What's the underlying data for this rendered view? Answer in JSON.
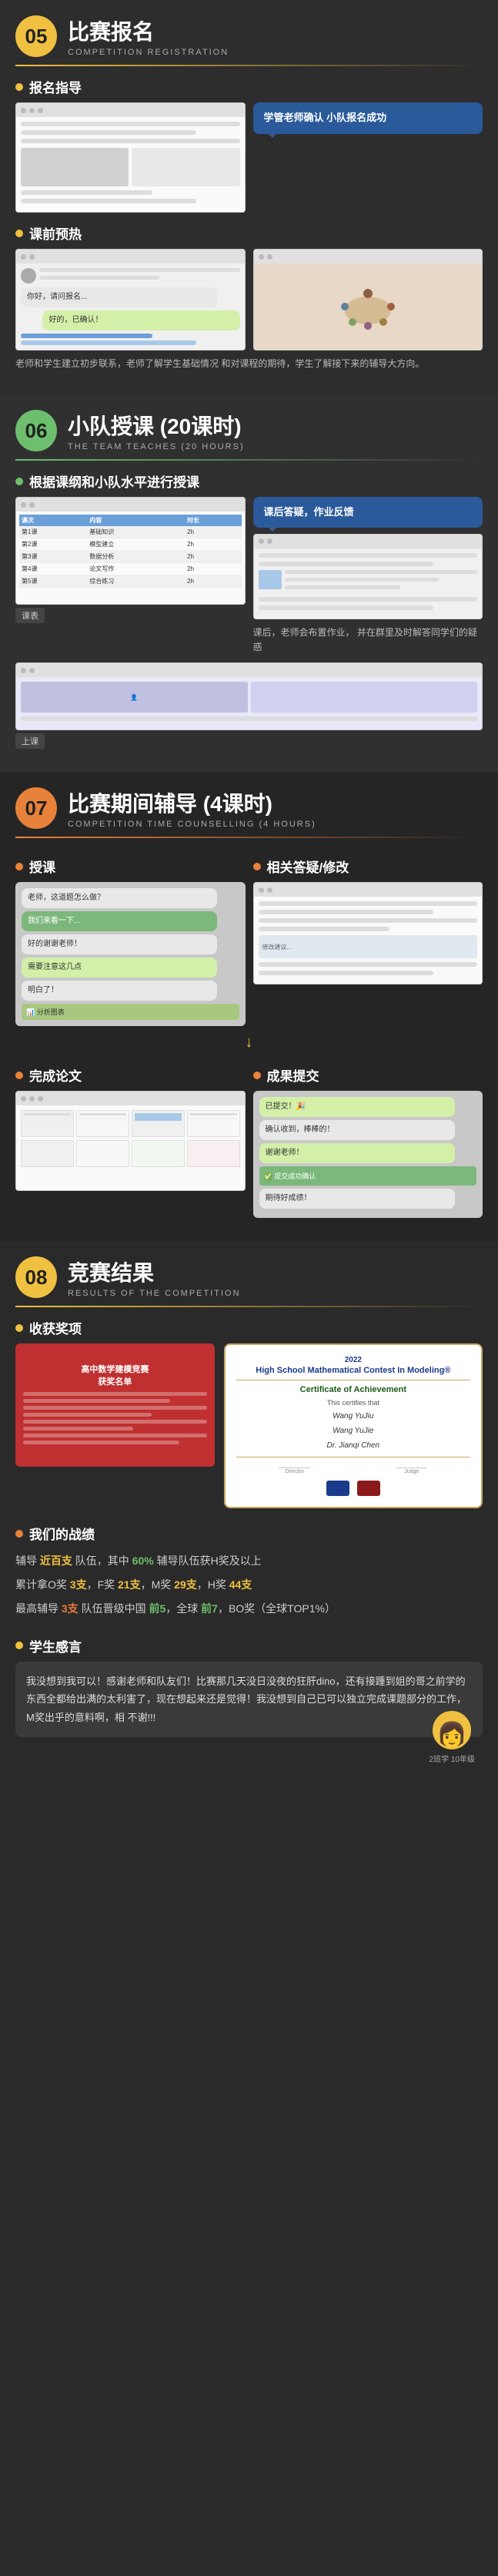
{
  "sections": {
    "s05": {
      "num": "05",
      "num_color": "yellow",
      "title": "比赛报名",
      "subtitle": "COMPETITION REGISTRATION",
      "items": [
        {
          "label": "报名指导",
          "dot_color": "yellow"
        }
      ],
      "callout1": "学管老师确认\n小队报名成功",
      "label1": "课前预热",
      "caption1": "老师和学生建立初步联系，老师了解学生基础情况\n和对课程的期待，学生了解接下来的辅导大方向。"
    },
    "s06": {
      "num": "06",
      "num_color": "green",
      "title": "小队授课 (20课时)",
      "subtitle": "THE TEAM TEACHES (20 HOURS)",
      "item1": "根据课纲和小队水平进行授课",
      "label_table": "课表",
      "label_class": "上课",
      "callout2": "课后答疑，作业反馈",
      "caption2": "课后，老师会布置作业，\n并在群里及时解答同学们的疑惑"
    },
    "s07": {
      "num": "07",
      "num_color": "orange",
      "title": "比赛期间辅导 (4课时)",
      "subtitle": "COMPETITION TIME COUNSELLING (4 HOURS)",
      "item1": "授课",
      "item2": "相关答疑/修改",
      "item3": "完成论文",
      "item4": "成果提交"
    },
    "s08": {
      "num": "08",
      "num_color": "yellow",
      "title": "竞赛结果",
      "subtitle": "RESULTS OF THE COMPETITION",
      "award_title": "收获奖项",
      "cert_year": "2022",
      "cert_title": "High School Mathematical Contest In Modeling®",
      "cert_subtitle": "Certificate of Achievement",
      "cert_body": "This certifies that\nWang YuJiu\nWang YuJie\nDr. Jianqi Chen",
      "cert_sign_line": "________________________",
      "battle_title": "我们的战绩",
      "battle_dot": "orange",
      "stats": {
        "line1": "辅导 近百支 队伍，其中 60% 辅导队伍获H奖及以上",
        "line2": "累计拿O奖 3支，F奖 21支，M奖 29支，H奖 44支",
        "line3": "最高辅导 3支 队伍晋级中国 前5，全球 前7，BO奖（全球TOP1%）"
      },
      "student_title": "学生感言",
      "student_comment": "我没想到我可以！感谢老师和队友们！比赛那几天没日没夜的狂肝dino，还有接踵到姐的哥之前学的东西全都给出满的太利害了，现在想起来还是觉得！我没想到自己已可以独立完成课题部分的工作，M奖出乎的意料啊，相 不谢!!!",
      "student_grade": "2班学 10年级"
    }
  }
}
